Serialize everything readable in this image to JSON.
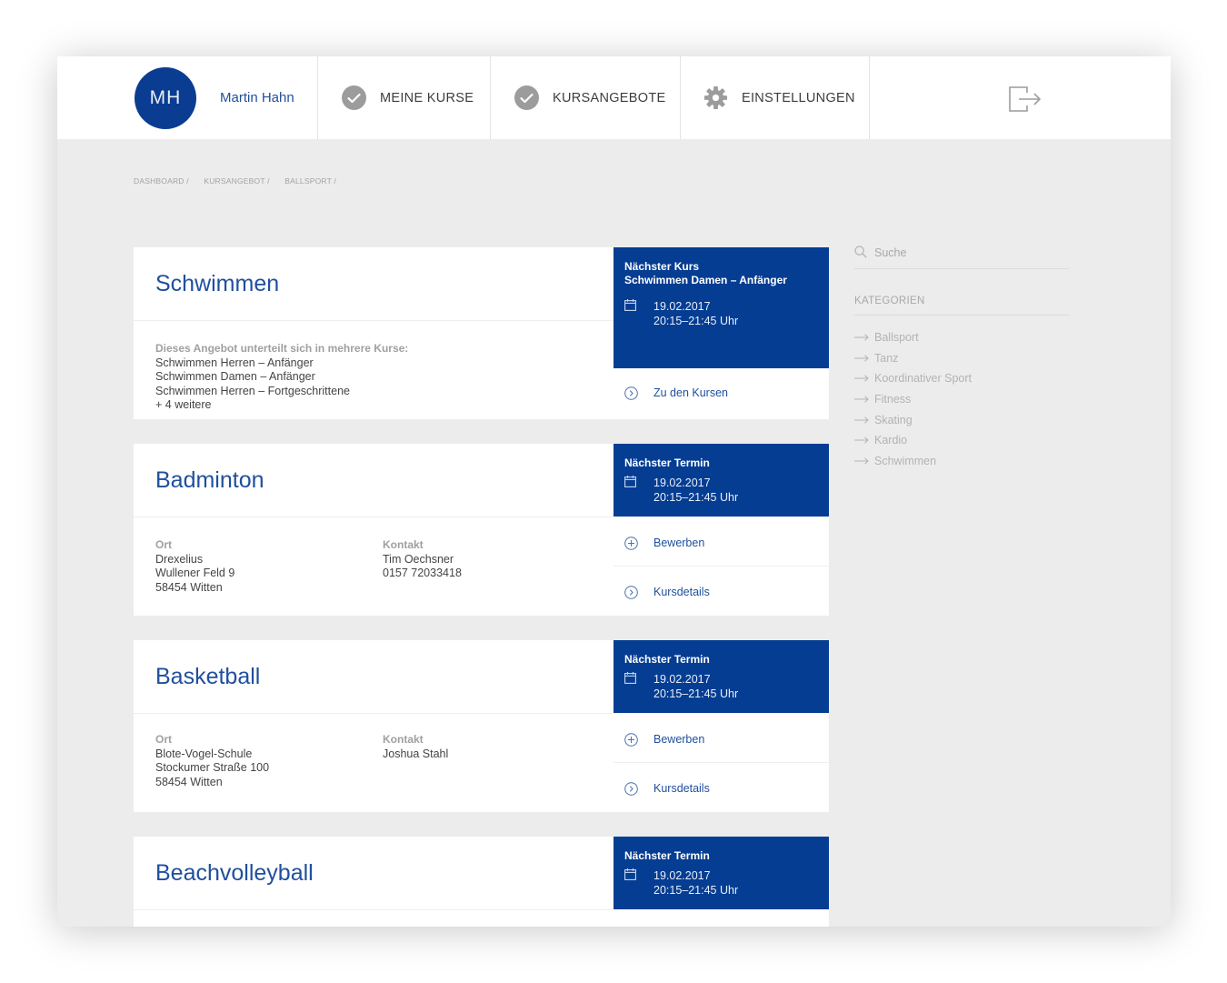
{
  "header": {
    "avatar_initials": "MH",
    "user_name": "Martin Hahn",
    "nav": [
      {
        "label": "MEINE KURSE",
        "icon": "check-circle-icon"
      },
      {
        "label": "KURSANGEBOTE",
        "icon": "check-circle-icon"
      },
      {
        "label": "EINSTELLUNGEN",
        "icon": "gear-icon"
      }
    ],
    "logout_icon": "logout-icon"
  },
  "breadcrumb": [
    "DASHBOARD /",
    "KURSANGEBOT /",
    "BALLSPORT /"
  ],
  "cards": [
    {
      "title": "Schwimmen",
      "intro": "Dieses Angebot unterteilt sich in mehrere Kurse:",
      "courses": [
        "Schwimmen Herren – Anfänger",
        "Schwimmen Damen – Anfänger",
        "Schwimmen Herren – Fortgeschrittene",
        "+ 4 weitere"
      ],
      "box_title": "Nächster Kurs",
      "box_subtitle": "Schwimmen Damen – Anfänger",
      "date": "19.02.2017",
      "time": "20:15–21:45 Uhr",
      "action": "Zu den Kursen"
    },
    {
      "title": "Badminton",
      "ort_label": "Ort",
      "ort": [
        "Drexelius",
        "Wullener Feld 9",
        "58454 Witten"
      ],
      "kontakt_label": "Kontakt",
      "kontakt": [
        "Tim Oechsner",
        "0157 72033418"
      ],
      "box_title": "Nächster Termin",
      "date": "19.02.2017",
      "time": "20:15–21:45 Uhr",
      "action_apply": "Bewerben",
      "action_details": "Kursdetails"
    },
    {
      "title": "Basketball",
      "ort_label": "Ort",
      "ort": [
        "Blote-Vogel-Schule",
        "Stockumer Straße 100",
        "58454 Witten"
      ],
      "kontakt_label": "Kontakt",
      "kontakt": [
        "Joshua Stahl"
      ],
      "box_title": "Nächster Termin",
      "date": "19.02.2017",
      "time": "20:15–21:45 Uhr",
      "action_apply": "Bewerben",
      "action_details": "Kursdetails"
    },
    {
      "title": "Beachvolleyball",
      "box_title": "Nächster Termin",
      "date": "19.02.2017",
      "time": "20:15–21:45 Uhr"
    }
  ],
  "sidebar": {
    "search_placeholder": "Suche",
    "categories_heading": "KATEGORIEN",
    "categories": [
      "Ballsport",
      "Tanz",
      "Koordinativer Sport",
      "Fitness",
      "Skating",
      "Kardio",
      "Schwimmen"
    ]
  },
  "colors": {
    "brand_blue": "#053d92",
    "link_blue": "#1f4f9e",
    "background": "#ececec"
  }
}
